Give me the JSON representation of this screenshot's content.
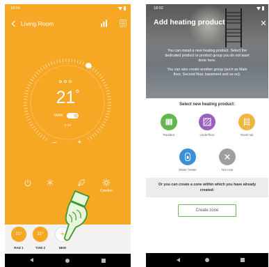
{
  "colors": {
    "app_orange": "#f6a724",
    "zone_bar_background": "#f3f2f0",
    "pointer_green": "#3a9a2a",
    "create_zone_border": "#66bb55",
    "zone_band_grey": "#ececec",
    "nav_bar_black": "#000000"
  },
  "left_screen": {
    "status_bar": {
      "time": "18:06",
      "icons": [
        "wifi-icon",
        "battery-icon"
      ]
    },
    "header": {
      "back_icon": "back-arrow-icon",
      "title": "Living Room",
      "stats_icon": "bar-chart-icon",
      "menu_icon": "settings-menu-icon"
    },
    "dial": {
      "indicator_fraction": 0.6,
      "temperature": "21",
      "unit": "°",
      "mode_label": "MAN",
      "manual_toggle_on": true,
      "area_label": "0 m²",
      "decrease_label": "−",
      "increase_label": "+"
    },
    "modes": [
      {
        "icon": "power-icon",
        "active": false
      },
      {
        "icon": "snowflake-icon",
        "active": false
      },
      {
        "icon": "leaf-icon",
        "active": false
      },
      {
        "icon": "sun-icon",
        "label": "Comfort",
        "active": true
      }
    ],
    "zones": [
      {
        "temperature": "21°",
        "label": "RAD 1"
      },
      {
        "temperature": "21°",
        "label": "TOW 2"
      },
      {
        "symbol": "+",
        "label": "NEW"
      }
    ],
    "pointer_icon": "pointing-hand-icon",
    "nav_bar": [
      "back-triangle-icon",
      "home-circle-icon",
      "recents-square-icon"
    ]
  },
  "right_screen": {
    "status_bar": {
      "time": "18:02",
      "icons": [
        "wifi-icon",
        "battery-icon"
      ]
    },
    "title": "Add heating product",
    "close_icon": "close-icon",
    "description": {
      "paragraph_1": [
        "You can install a new heating product. Select the",
        "dedicated product or product group you do not want",
        "done here."
      ],
      "paragraph_2": [
        "You can also create another group (such as Main",
        "floor, Second floor, basement and so on)."
      ]
    },
    "select_prompt": "Select new heating product:",
    "products": [
      {
        "label": "Radiator",
        "icon": "radiator-icon",
        "color": "#62b84f"
      },
      {
        "label": "Underfloor",
        "icon": "underfloor-icon",
        "color": "#9b5fc0"
      },
      {
        "label": "Towel rail",
        "icon": "towel-rail-icon",
        "color": "#f0b53e"
      },
      {
        "label": "Water heater",
        "icon": "water-heater-icon",
        "color": "#3b8fd6"
      },
      {
        "label": "Not now",
        "icon": "close-icon",
        "color": "#9e9e9e"
      }
    ],
    "zone_prompt": [
      "Or you can create a zone within which you have already",
      "created:"
    ],
    "create_zone_label": "Create zone",
    "nav_bar": [
      "back-triangle-icon",
      "home-circle-icon",
      "recents-square-icon"
    ]
  }
}
